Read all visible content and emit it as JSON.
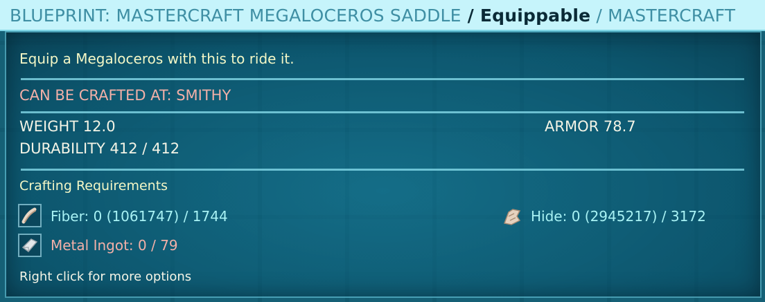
{
  "title": {
    "main": "BLUEPRINT: MASTERCRAFT MEGALOCEROS SADDLE",
    "separator1": " / ",
    "category": "Equippable",
    "separator2": " / ",
    "quality": "MASTERCRAFT"
  },
  "description": "Equip a Megaloceros with this to ride it.",
  "crafted_at": "CAN BE CRAFTED AT: SMITHY",
  "stats": {
    "weight": "WEIGHT 12.0",
    "armor": "ARMOR 78.7",
    "durability": "DURABILITY 412 / 412"
  },
  "requirements": {
    "heading": "Crafting Requirements",
    "items": [
      {
        "label": "Fiber: 0 (1061747) / 1744",
        "status": "ok",
        "icon": "fiber-icon"
      },
      {
        "label": "Hide: 0 (2945217) / 3172",
        "status": "ok",
        "icon": "hide-icon"
      },
      {
        "label": "Metal Ingot: 0 / 79",
        "status": "missing",
        "icon": "metal-ingot-icon"
      }
    ]
  },
  "hint": "Right click for more options",
  "colors": {
    "title_bg": "#c6f4fb",
    "title_dim": "#3f8fa4",
    "available": "#a8f2f4",
    "missing": "#f2b0a8",
    "description": "#f3f7c6"
  }
}
